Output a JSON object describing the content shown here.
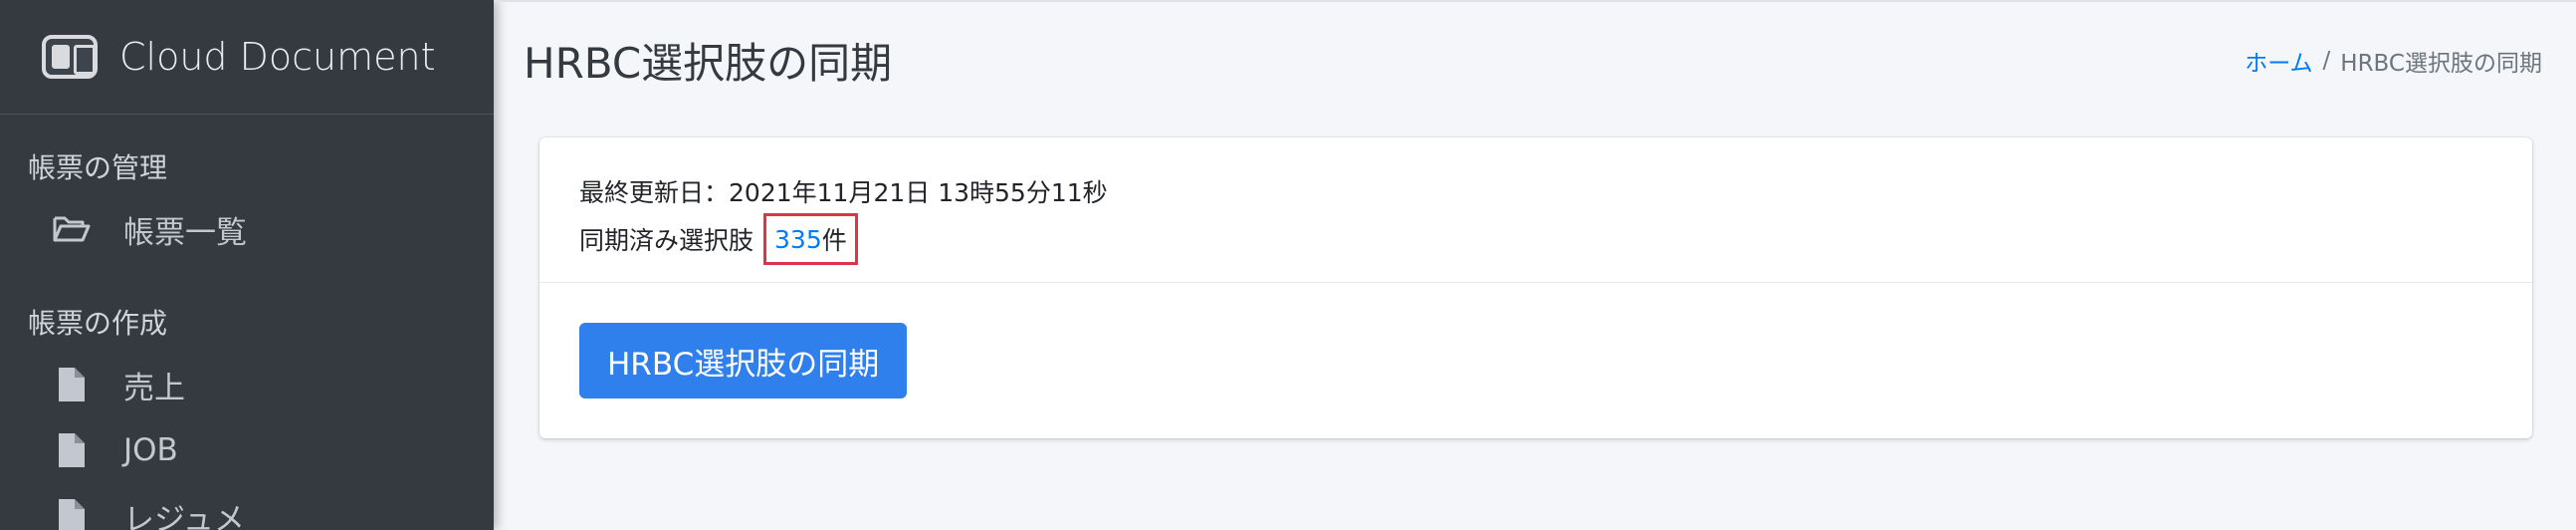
{
  "sidebar": {
    "brand": "Cloud Document",
    "sections": [
      {
        "header": "帳票の管理",
        "items": [
          {
            "label": "帳票一覧",
            "icon": "folder-open-icon"
          }
        ]
      },
      {
        "header": "帳票の作成",
        "items": [
          {
            "label": "売上",
            "icon": "file-icon"
          },
          {
            "label": "JOB",
            "icon": "file-icon"
          },
          {
            "label": "レジュメ",
            "icon": "file-icon"
          }
        ]
      }
    ]
  },
  "page": {
    "title": "HRBC選択肢の同期",
    "breadcrumb": {
      "home": "ホーム",
      "separator": "/",
      "current": "HRBC選択肢の同期"
    }
  },
  "card": {
    "last_updated_label": "最終更新日：",
    "last_updated_value": "2021年11月21日 13時55分11秒",
    "synced_label": "同期済み選択肢",
    "synced_count": "335",
    "synced_unit": "件",
    "sync_button_label": "HRBC選択肢の同期"
  },
  "colors": {
    "sidebar_bg": "#343a40",
    "primary": "#2f80ed",
    "link": "#007bff",
    "highlight_border": "#dc3545"
  }
}
